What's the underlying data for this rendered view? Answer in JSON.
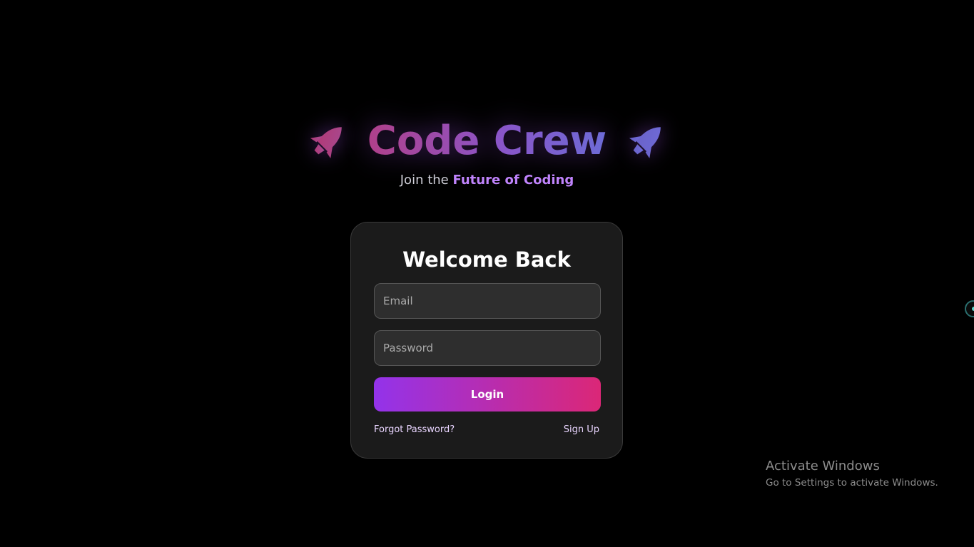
{
  "brand": {
    "title": "Code Crew",
    "tagline_prefix": "Join the ",
    "tagline_accent": "Future of Coding",
    "left_icon": "rocket-icon",
    "right_icon": "rocket-icon",
    "gradient_colors": [
      "#b0408a",
      "#8a55c8",
      "#6d6bd6"
    ]
  },
  "login_card": {
    "title": "Welcome Back",
    "email_placeholder": "Email",
    "email_value": "",
    "password_placeholder": "Password",
    "password_value": "",
    "login_label": "Login",
    "forgot_password_label": "Forgot Password?",
    "sign_up_label": "Sign Up",
    "button_gradient": [
      "#9333ea",
      "#db2777"
    ]
  },
  "os_watermark": {
    "title": "Activate Windows",
    "subtitle": "Go to Settings to activate Windows."
  },
  "colors": {
    "background": "#000000",
    "card_background": "#1b1b1b",
    "accent": "#c084fc",
    "link": "#e9d5ff"
  }
}
